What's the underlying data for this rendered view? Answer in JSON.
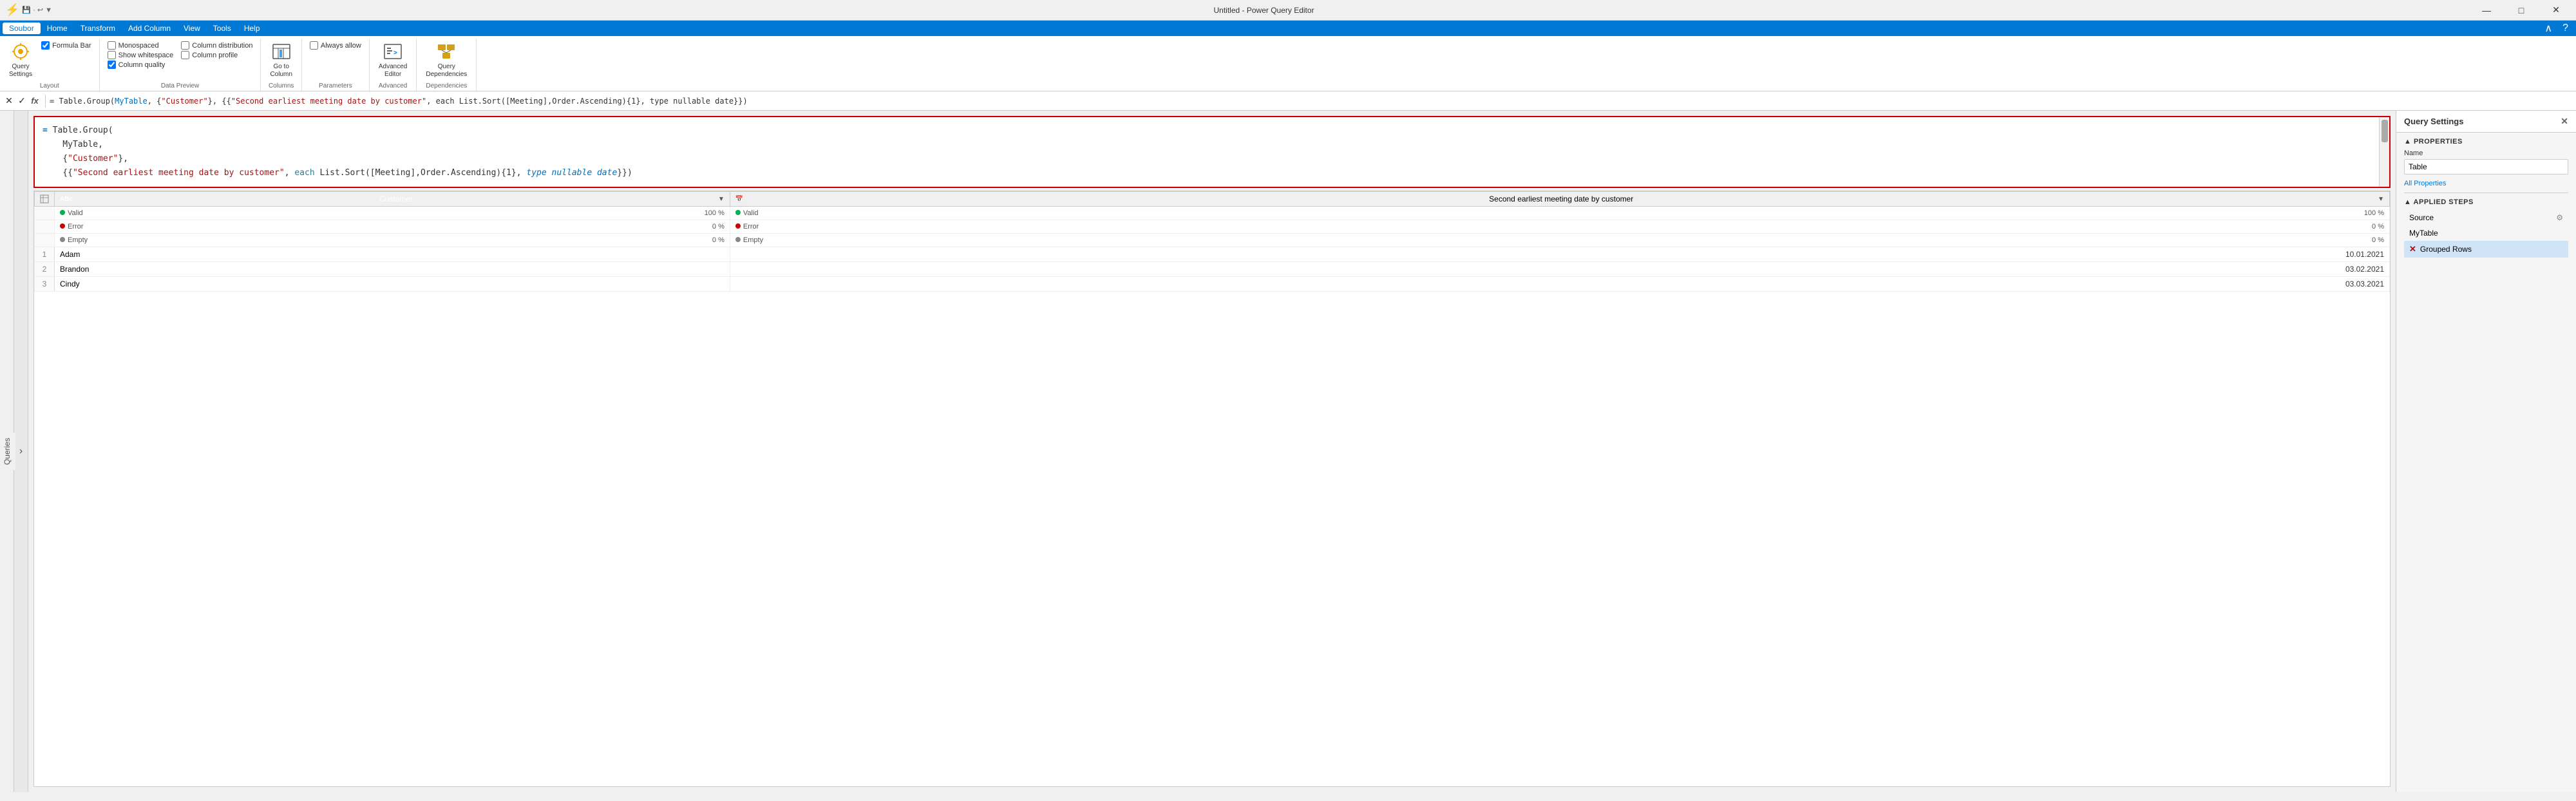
{
  "titleBar": {
    "icon": "⚡",
    "title": "Untitled - Power Query Editor",
    "minimize": "—",
    "maximize": "□",
    "close": "✕"
  },
  "menuBar": {
    "items": [
      "Soubor",
      "Home",
      "Transform",
      "Add Column",
      "View",
      "Tools",
      "Help"
    ],
    "activeItem": "Soubor"
  },
  "ribbon": {
    "groups": [
      {
        "name": "Layout",
        "label": "Layout",
        "items": [
          {
            "type": "button-large",
            "icon": "⚙",
            "label": "Query\nSettings",
            "name": "query-settings-btn"
          }
        ],
        "checkboxes": [
          {
            "label": "Formula Bar",
            "checked": true,
            "name": "formula-bar-checkbox"
          }
        ]
      },
      {
        "name": "Data Preview",
        "label": "Data Preview",
        "checkboxes": [
          {
            "label": "Monospaced",
            "checked": false,
            "name": "monospaced-checkbox"
          },
          {
            "label": "Show whitespace",
            "checked": false,
            "name": "show-whitespace-checkbox"
          },
          {
            "label": "Column quality",
            "checked": true,
            "name": "column-quality-checkbox"
          },
          {
            "label": "Column distribution",
            "checked": false,
            "name": "column-distribution-checkbox"
          },
          {
            "label": "Column profile",
            "checked": false,
            "name": "column-profile-checkbox"
          }
        ]
      },
      {
        "name": "Columns",
        "label": "Columns",
        "items": [
          {
            "type": "button-large",
            "icon": "⊞",
            "label": "Go to\nColumn",
            "name": "go-to-column-btn"
          }
        ]
      },
      {
        "name": "Parameters",
        "label": "Parameters",
        "checkboxes": [
          {
            "label": "Always allow",
            "checked": false,
            "name": "always-allow-checkbox"
          }
        ]
      },
      {
        "name": "Advanced",
        "label": "Advanced",
        "items": [
          {
            "type": "button-large",
            "icon": "📝",
            "label": "Advanced\nEditor",
            "name": "advanced-editor-btn"
          }
        ]
      },
      {
        "name": "Dependencies",
        "label": "Dependencies",
        "items": [
          {
            "type": "button-large",
            "icon": "🗄",
            "label": "Query\nDependencies",
            "name": "query-dependencies-btn"
          }
        ]
      }
    ]
  },
  "formulaBar": {
    "cancelIcon": "✕",
    "confirmIcon": "✓",
    "fxIcon": "fx",
    "formula": "= Table.Group(MyTable, {\"Customer\"}, {{\"Second earliest meeting date by customer\", each List.Sort([Meeting],Order.Ascending){1}, type nullable date}})"
  },
  "formulaEditor": {
    "line1": "= Table.Group(",
    "line2": "    MyTable,",
    "line3": "    {\"Customer\"},",
    "line4": "    {{\"Second earliest meeting date by customer\", each List.Sort([Meeting],Order.Ascending){1}, type nullable date}})"
  },
  "dataTable": {
    "columns": [
      {
        "type": "abc",
        "name": "Customer",
        "label": "Customer",
        "isHighlighted": true
      },
      {
        "type": "date",
        "name": "SecondEarliest",
        "label": "Second earliest meeting date by customer",
        "isHighlighted": false
      }
    ],
    "qualityRows": [
      {
        "col1": {
          "valid": "100 %",
          "error": "0 %",
          "empty": "0 %"
        },
        "col2": {
          "valid": "100 %",
          "error": "0 %",
          "empty": "0 %"
        }
      }
    ],
    "rows": [
      {
        "num": "1",
        "col1": "Adam",
        "col2": "10.01.2021"
      },
      {
        "num": "2",
        "col1": "Brandon",
        "col2": "03.02.2021"
      },
      {
        "num": "3",
        "col1": "Cindy",
        "col2": "03.03.2021"
      }
    ]
  },
  "rightPanel": {
    "title": "Query Settings",
    "closeIcon": "✕",
    "propertiesSection": {
      "label": "PROPERTIES",
      "nameLabel": "Name",
      "nameValue": "Table",
      "allPropertiesLink": "All Properties"
    },
    "appliedSteps": {
      "label": "APPLIED STEPS",
      "steps": [
        {
          "name": "Source",
          "hasGear": true,
          "isActive": false,
          "hasX": false
        },
        {
          "name": "MyTable",
          "hasGear": false,
          "isActive": false,
          "hasX": false
        },
        {
          "name": "Grouped Rows",
          "hasGear": false,
          "isActive": true,
          "hasX": true
        }
      ]
    }
  },
  "sidebar": {
    "label": "Queries"
  },
  "colors": {
    "accent": "#0078d4",
    "menuBg": "#0078d4",
    "customerHeader": "#d4a017",
    "errorRed": "#cc0000",
    "formulaBorderRed": "#cc0000"
  }
}
